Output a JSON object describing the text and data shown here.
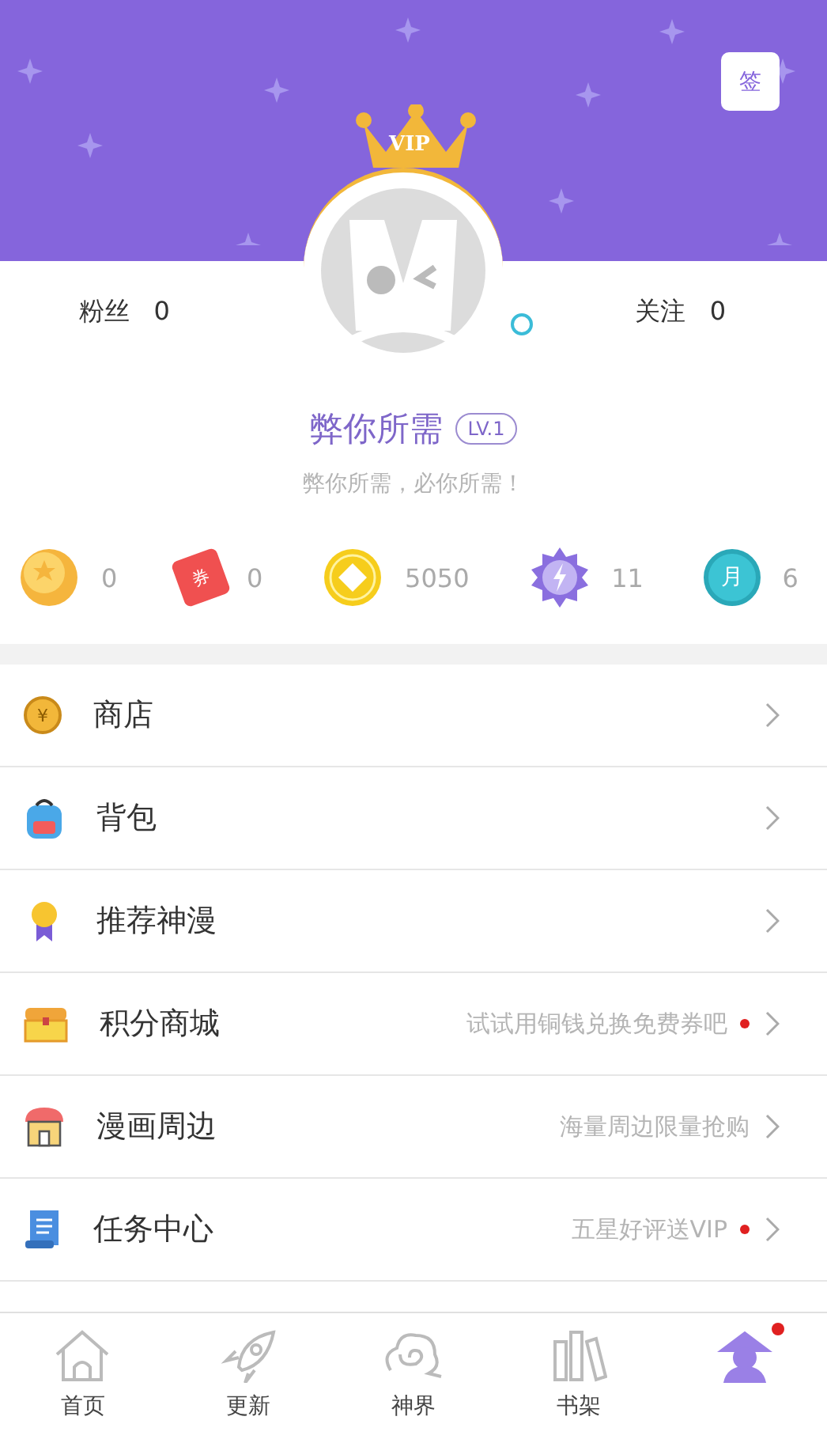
{
  "header": {
    "sign_in_label": "签",
    "vip_label": "VIP"
  },
  "stats": [
    {
      "label": "粉丝",
      "value": "0"
    },
    {
      "label": "关注",
      "value": "0"
    }
  ],
  "profile": {
    "name": "弊你所需",
    "level": "LV.1",
    "motto": "弊你所需，必你所需！"
  },
  "currencies": [
    {
      "value": "0"
    },
    {
      "value": "0",
      "glyph": "券"
    },
    {
      "value": "5050"
    },
    {
      "value": "11"
    },
    {
      "value": "6",
      "glyph": "月"
    }
  ],
  "menu": [
    {
      "label": "商店",
      "glyph": "¥",
      "dot": false
    },
    {
      "label": "背包",
      "dot": false
    },
    {
      "label": "推荐神漫",
      "dot": false
    },
    {
      "label": "积分商城",
      "hint": "试试用铜钱兑换免费券吧",
      "dot": true
    },
    {
      "label": "漫画周边",
      "hint": "海量周边限量抢购",
      "dot": false
    },
    {
      "label": "任务中心",
      "hint": "五星好评送VIP",
      "dot": true
    }
  ],
  "tabs": [
    {
      "label": "首页",
      "selected": false,
      "badge": false
    },
    {
      "label": "更新",
      "selected": false,
      "badge": false
    },
    {
      "label": "神界",
      "selected": false,
      "badge": false
    },
    {
      "label": "书架",
      "selected": false,
      "badge": false
    },
    {
      "selected": true,
      "badge": true
    }
  ]
}
